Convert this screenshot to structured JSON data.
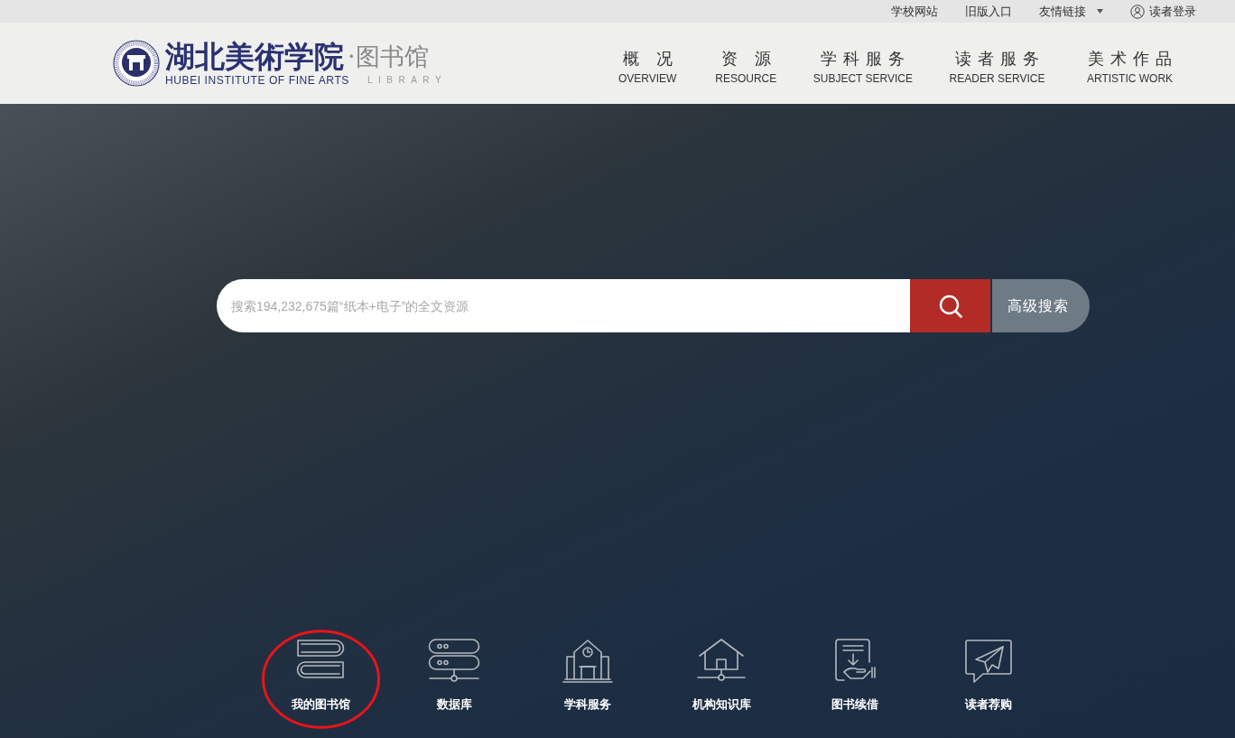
{
  "top_bar": {
    "links": [
      {
        "label": "学校网站",
        "kind": "plain"
      },
      {
        "label": "旧版入口",
        "kind": "plain"
      },
      {
        "label": "友情链接",
        "kind": "dropdown"
      },
      {
        "label": "读者登录",
        "kind": "account"
      }
    ]
  },
  "header": {
    "logo": {
      "name": "湖北美術学院",
      "separator": "·",
      "library": "图书馆",
      "english_name": "HUBEI INSTITUTE OF FINE ARTS",
      "english_library": "LIBRARY"
    },
    "nav": [
      {
        "label": "概 况",
        "sublabel": "OVERVIEW"
      },
      {
        "label": "资 源",
        "sublabel": "RESOURCE"
      },
      {
        "label": "学科服务",
        "sublabel": "SUBJECT SERVICE"
      },
      {
        "label": "读者服务",
        "sublabel": "READER SERVICE"
      },
      {
        "label": "美术作品",
        "sublabel": "ARTISTIC WORK"
      }
    ]
  },
  "search": {
    "placeholder": "搜索194,232,675篇“纸本+电子”的全文资源",
    "advanced_button": "高级搜索"
  },
  "quick_links": [
    {
      "label": "我的图书馆",
      "kind": "books",
      "highlighted": true
    },
    {
      "label": "数据库",
      "kind": "database",
      "highlighted": false
    },
    {
      "label": "学科服务",
      "kind": "school",
      "highlighted": false
    },
    {
      "label": "机构知识库",
      "kind": "repository",
      "highlighted": false
    },
    {
      "label": "图书续借",
      "kind": "renewal",
      "highlighted": false
    },
    {
      "label": "读者荐购",
      "kind": "recommend",
      "highlighted": false
    }
  ]
}
